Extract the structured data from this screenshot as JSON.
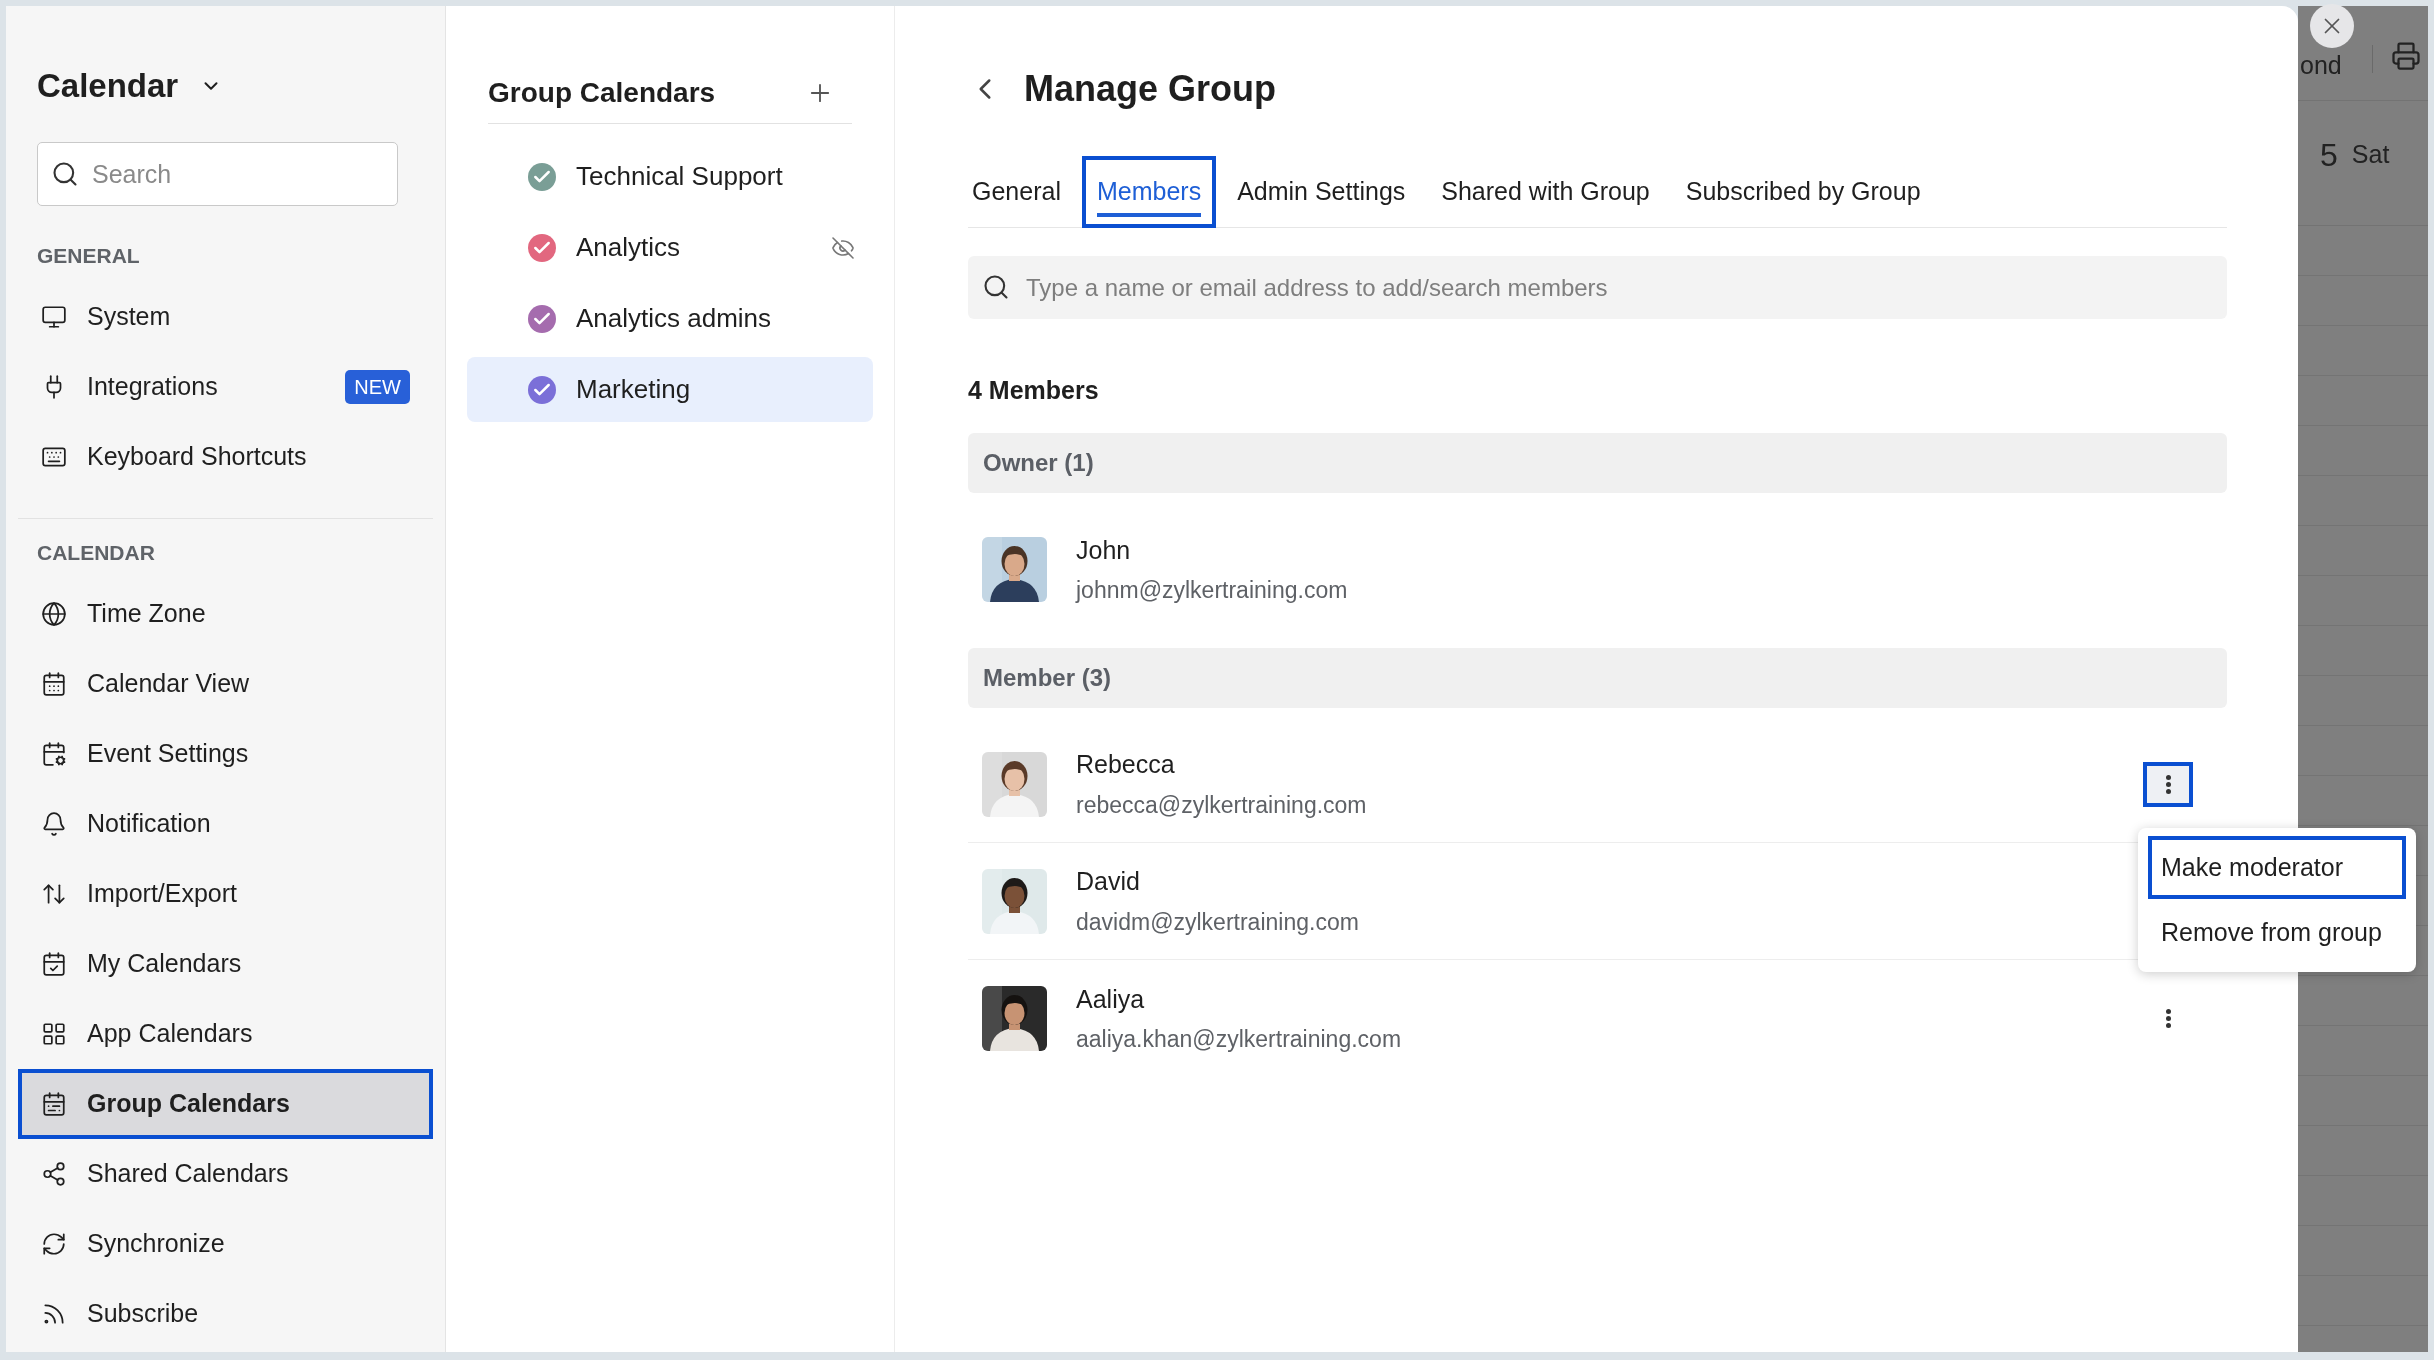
{
  "sidebar": {
    "title": "Calendar",
    "search": {
      "placeholder": "Search"
    },
    "sections": [
      {
        "heading": "GENERAL",
        "items": [
          {
            "label": "System",
            "selected": false,
            "highlighted": false
          },
          {
            "label": "Integrations",
            "badge": "NEW",
            "selected": false,
            "highlighted": false
          },
          {
            "label": "Keyboard Shortcuts",
            "selected": false,
            "highlighted": false
          }
        ]
      },
      {
        "heading": "CALENDAR",
        "items": [
          {
            "label": "Time Zone",
            "selected": false,
            "highlighted": false
          },
          {
            "label": "Calendar View",
            "selected": false,
            "highlighted": false
          },
          {
            "label": "Event Settings",
            "selected": false,
            "highlighted": false
          },
          {
            "label": "Notification",
            "selected": false,
            "highlighted": false
          },
          {
            "label": "Import/Export",
            "selected": false,
            "highlighted": false
          },
          {
            "label": "My Calendars",
            "selected": false,
            "highlighted": false
          },
          {
            "label": "App Calendars",
            "selected": false,
            "highlighted": false
          },
          {
            "label": "Group Calendars",
            "selected": true,
            "highlighted": true
          },
          {
            "label": "Shared Calendars",
            "selected": false,
            "highlighted": false
          },
          {
            "label": "Synchronize",
            "selected": false,
            "highlighted": false
          },
          {
            "label": "Subscribe",
            "selected": false,
            "highlighted": false
          }
        ]
      }
    ]
  },
  "group_calendars": {
    "title": "Group Calendars",
    "items": [
      {
        "label": "Technical Support",
        "color": "#7a9e96",
        "selected": false,
        "hidden": false
      },
      {
        "label": "Analytics",
        "color": "#e2677f",
        "selected": false,
        "hidden": true
      },
      {
        "label": "Analytics admins",
        "color": "#a56cae",
        "selected": false,
        "hidden": false
      },
      {
        "label": "Marketing",
        "color": "#7b6fd8",
        "selected": true,
        "hidden": false
      }
    ]
  },
  "manage_group": {
    "title": "Manage Group",
    "tabs": [
      {
        "label": "General",
        "selected": false,
        "highlighted": false
      },
      {
        "label": "Members",
        "selected": true,
        "highlighted": true
      },
      {
        "label": "Admin Settings",
        "selected": false,
        "highlighted": false
      },
      {
        "label": "Shared with Group",
        "selected": false,
        "highlighted": false
      },
      {
        "label": "Subscribed by Group",
        "selected": false,
        "highlighted": false
      }
    ],
    "search": {
      "placeholder": "Type a name or email address to add/search members"
    },
    "count": "4 Members",
    "groups": [
      {
        "heading": "Owner (1)",
        "members": [
          {
            "name": "John",
            "email": "johnm@zylkertraining.com"
          }
        ]
      },
      {
        "heading": "Member (3)",
        "members": [
          {
            "name": "Rebecca",
            "email": "rebecca@zylkertraining.com",
            "menu_button": true,
            "menu_highlighted": true
          },
          {
            "name": "David",
            "email": "davidm@zylkertraining.com"
          },
          {
            "name": "Aaliya",
            "email": "aaliya.khan@zylkertraining.com",
            "menu_button": true,
            "menu_highlighted": false
          }
        ]
      }
    ],
    "context_menu": {
      "items": [
        {
          "label": "Make moderator",
          "highlighted": true
        },
        {
          "label": "Remove from group",
          "highlighted": false
        }
      ]
    }
  },
  "background_calendar": {
    "button": "ond",
    "day_number": "5",
    "day_name": "Sat"
  }
}
